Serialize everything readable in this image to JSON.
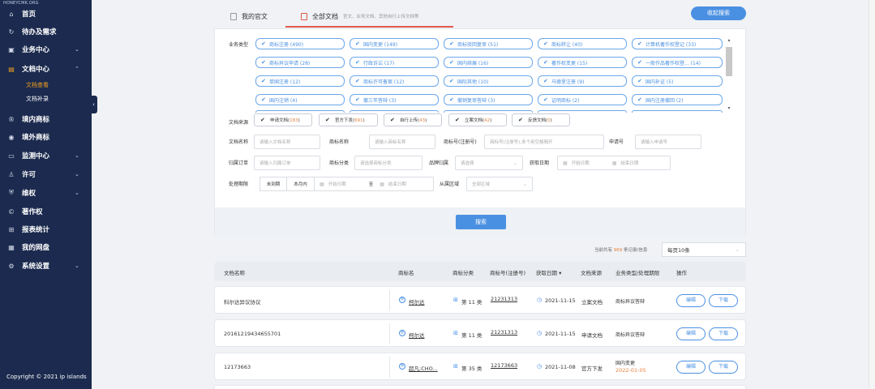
{
  "sidebar": {
    "logo": "HONEYCMK.ORG",
    "items": [
      {
        "label": "首页",
        "icon": "home-icon",
        "glyph": "⌂"
      },
      {
        "label": "待办及需求",
        "icon": "todo-icon",
        "glyph": "↻"
      },
      {
        "label": "业务中心",
        "icon": "briefcase-icon",
        "glyph": "▣"
      },
      {
        "label": "文档中心",
        "icon": "folder-icon",
        "glyph": "▤"
      },
      {
        "label": "境内商标",
        "icon": "registered-icon",
        "glyph": "®"
      },
      {
        "label": "境外商标",
        "icon": "globe-icon",
        "glyph": "◉"
      },
      {
        "label": "监测中心",
        "icon": "monitor-icon",
        "glyph": "▭"
      },
      {
        "label": "许可",
        "icon": "user-icon",
        "glyph": "♙"
      },
      {
        "label": "维权",
        "icon": "shield-icon",
        "glyph": "⛨"
      },
      {
        "label": "著作权",
        "icon": "copyright-icon",
        "glyph": "©"
      },
      {
        "label": "报表统计",
        "icon": "cart-icon",
        "glyph": "⊞"
      },
      {
        "label": "我的网盘",
        "icon": "disk-icon",
        "glyph": "▦"
      },
      {
        "label": "系统设置",
        "icon": "gear-icon",
        "glyph": "⚙"
      }
    ],
    "subitems": [
      {
        "label": "文档查看"
      },
      {
        "label": "文档补录"
      }
    ],
    "copyright": "Copyright © 2021 ip islands"
  },
  "tabs": {
    "mine": "我的官文",
    "all": "全部文档",
    "all_desc": "官文、业务文档、其他自行上传文档等",
    "collapse_search": "收起搜索"
  },
  "filters": {
    "business_type_label": "业务类型",
    "chips": [
      "商标注册 (490)",
      "国内变更 (149)",
      "商标驳回复审 (51)",
      "商标转让 (40)",
      "计算机著作权登记 (33)",
      "商标异议申请 (28)",
      "行政诉讼 (17)",
      "国内续展 (16)",
      "著作权变更 (15)",
      "一般作品著作权登... (14)",
      "单国注册 (12)",
      "商标许可备案 (12)",
      "国际其他 (10)",
      "马德里注册 (9)",
      "国内补证 (5)",
      "国内注销 (4)",
      "撤三年答辩 (3)",
      "撤销复审答辩 (3)",
      "证明商标 (2)",
      "国内注册撤回 (2)"
    ],
    "source_label": "文档来源",
    "sources": [
      {
        "name": "申请文档(",
        "count": "183",
        "close": ")"
      },
      {
        "name": "官方下发(",
        "count": "691",
        "close": ")"
      },
      {
        "name": "自行上传(",
        "count": "43",
        "close": ")"
      },
      {
        "name": "立案文档(",
        "count": "42",
        "close": ")"
      },
      {
        "name": "反馈文档(",
        "count": "0",
        "close": ")"
      }
    ],
    "doc_name_label": "文档名称",
    "doc_name_placeholder": "请输入文档名称",
    "tm_name_label": "商标名称",
    "tm_name_placeholder": "请输入商标名称",
    "reg_no_label": "商标号(注册号)",
    "reg_no_placeholder": "商标号(注册号),多个用空格隔开",
    "app_no_label": "申请号",
    "app_no_placeholder": "请输入申请号",
    "order_label": "归属订单",
    "order_placeholder": "请输入归属订单",
    "class_label": "商标分类",
    "class_placeholder": "请选择商标分类",
    "brand_label": "品牌归属",
    "brand_placeholder": "请选择",
    "get_date_label": "获取日期",
    "start_date": "开始日期",
    "end_date": "结束日期",
    "deadline_label": "处理期限",
    "not_due": "未到期",
    "this_month": "本月内",
    "to": "至",
    "region_label": "从属区域",
    "region_placeholder": "全部区域",
    "search_button": "搜索"
  },
  "pagination": {
    "prefix": "当前共有",
    "count": "969",
    "suffix": "条记录/信息",
    "per_page": "每页10条"
  },
  "table": {
    "headers": [
      "文档名称",
      "商标名",
      "商标分类",
      "商标号(注册号)",
      "获取日期 ▾",
      "文档来源",
      "业务类型/处理期限",
      "操作"
    ],
    "rows": [
      {
        "doc": "科尔达异议协议",
        "tm": "柯尔达",
        "cls": "第 11 类",
        "regno": "21231313",
        "date": "2021-11-15",
        "source": "立案文档",
        "biz": "商标异议答辩",
        "deadline": "",
        "edit": "编辑",
        "download": "下载"
      },
      {
        "doc": "20161219434655701",
        "tm": "柯尔达",
        "cls": "第 11 类",
        "regno": "21231313",
        "date": "2021-11-15",
        "source": "申请文档",
        "biz": "商标异议答辩",
        "deadline": "",
        "edit": "编辑",
        "download": "下载"
      },
      {
        "doc": "12173663",
        "tm": "超凡;CHO...",
        "cls": "第 35 类",
        "regno": "12173663",
        "date": "2021-11-08",
        "source": "官方下发",
        "biz": "国内变更",
        "deadline": "2022-01-05",
        "edit": "编辑",
        "download": "下载"
      }
    ]
  }
}
